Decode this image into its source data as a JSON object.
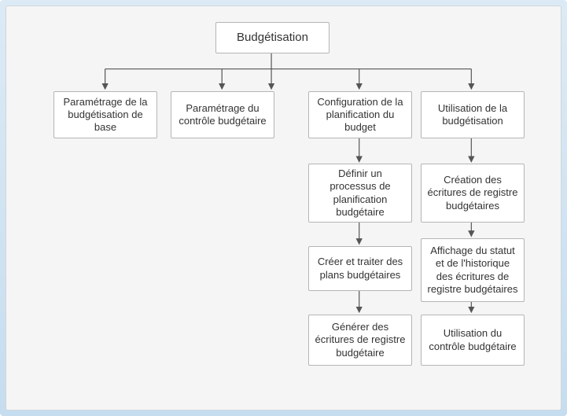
{
  "diagram": {
    "root": "Budgétisation",
    "col1": {
      "a": "Paramétrage de la budgétisation de base"
    },
    "col2": {
      "a": "Paramétrage du contrôle budgétaire"
    },
    "col3": {
      "a": "Configuration de la planification du budget",
      "b": "Définir un processus de planification budgétaire",
      "c": "Créer et traiter des plans budgétaires",
      "d": "Générer des écritures de registre budgétaire"
    },
    "col4": {
      "a": "Utilisation de la budgétisation",
      "b": "Création des écritures de registre budgétaires",
      "c": "Affichage du statut et de l'historique des écritures de registre budgétaires",
      "d": "Utilisation du contrôle budgétaire"
    }
  }
}
